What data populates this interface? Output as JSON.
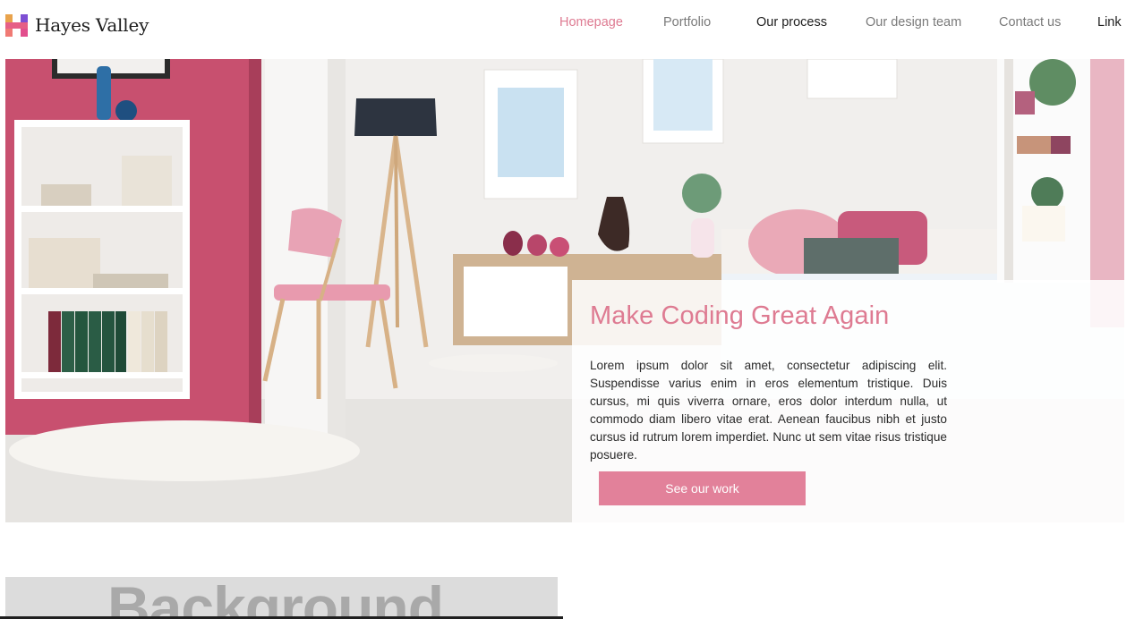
{
  "brand": {
    "name": "Hayes Valley",
    "logo_icon": "hv-logo-icon"
  },
  "nav": {
    "items": [
      {
        "label": "Homepage",
        "state": "active"
      },
      {
        "label": "Portfolio",
        "state": "muted"
      },
      {
        "label": "Our process",
        "state": "dark"
      },
      {
        "label": "Our design team",
        "state": "muted"
      },
      {
        "label": "Contact us",
        "state": "muted"
      },
      {
        "label": "Link",
        "state": "dark"
      }
    ]
  },
  "hero": {
    "image_alt": "Pink and white bedroom interior",
    "title": "Make Coding Great Again",
    "body": "Lorem ipsum dolor sit amet, consectetur adipiscing elit. Suspendisse varius enim in eros elementum tristique. Duis cursus, mi quis viverra ornare, eros dolor interdum nulla, ut commodo diam libero vitae erat. Aenean faucibus nibh et justo cursus id rutrum lorem imperdiet. Nunc ut sem vitae risus tristique posuere.",
    "cta_label": "See our work"
  },
  "section_preview": {
    "heading": "Background"
  },
  "colors": {
    "accent": "#de7b92",
    "button": "#e2819a",
    "wall": "#c54b6a"
  }
}
